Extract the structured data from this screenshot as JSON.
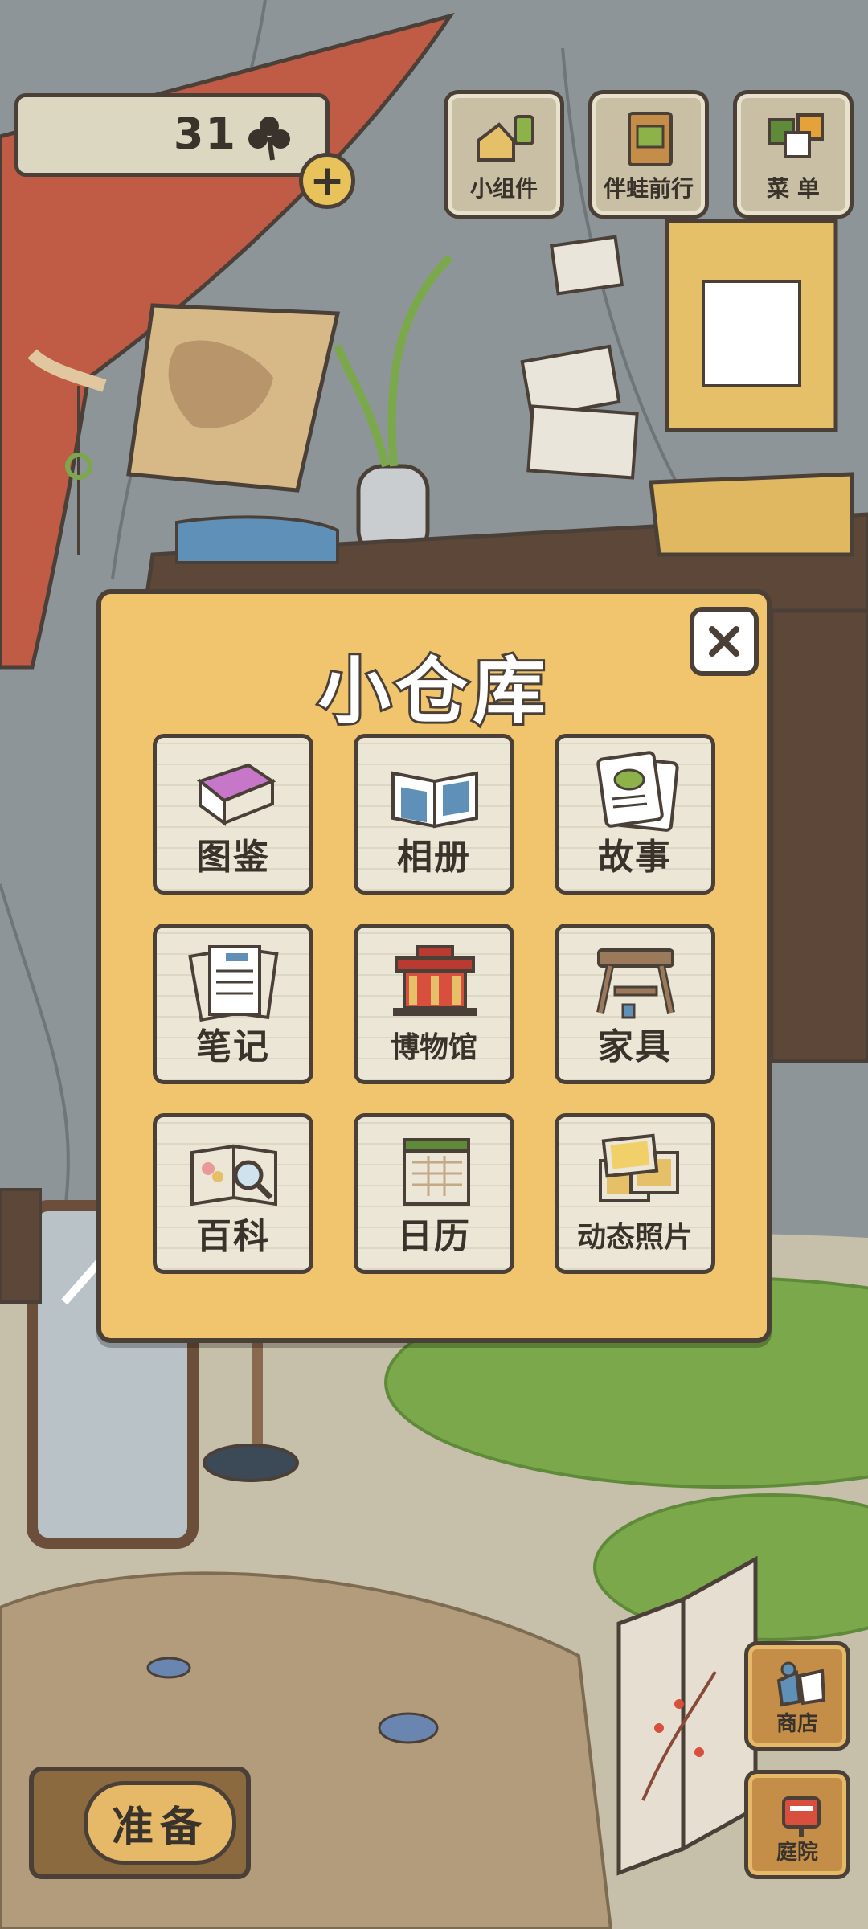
{
  "hud": {
    "clover_count": "31",
    "clover_icon": "clover-icon",
    "add_clover_symbol": "+"
  },
  "top_menu": [
    {
      "id": "widgets",
      "label": "小组件",
      "icon": "widget-icon"
    },
    {
      "id": "travel",
      "label": "伴蛙前行",
      "icon": "album-icon"
    },
    {
      "id": "menu",
      "label": "菜 单",
      "icon": "menu-cards-icon"
    }
  ],
  "storage": {
    "title": "小仓库",
    "close_icon": "close-icon",
    "items": [
      {
        "id": "encyclopedia-book",
        "label": "图鉴",
        "icon": "book-icon"
      },
      {
        "id": "album",
        "label": "相册",
        "icon": "photo-album-icon"
      },
      {
        "id": "stories",
        "label": "故事",
        "icon": "story-card-icon"
      },
      {
        "id": "notes",
        "label": "笔记",
        "icon": "notes-icon"
      },
      {
        "id": "museum",
        "label": "博物馆",
        "icon": "museum-icon"
      },
      {
        "id": "furniture",
        "label": "家具",
        "icon": "table-icon"
      },
      {
        "id": "wiki",
        "label": "百科",
        "icon": "magnifier-book-icon"
      },
      {
        "id": "calendar",
        "label": "日历",
        "icon": "calendar-icon"
      },
      {
        "id": "motion-photos",
        "label": "动态照片",
        "icon": "photo-frames-icon"
      }
    ]
  },
  "bottom": {
    "ready_label": "准备",
    "shop_label": "商店",
    "garden_label": "庭院"
  },
  "colors": {
    "panel": "#f0c56e",
    "outline": "#4a4038",
    "tile": "#ebe6d6",
    "curtain": "#c05b45",
    "grass": "#7aa84a"
  }
}
